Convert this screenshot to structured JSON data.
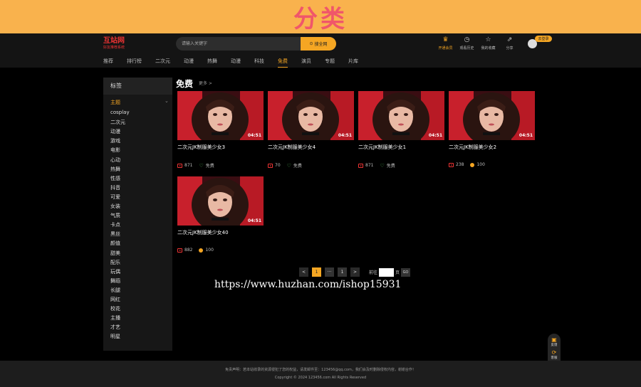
{
  "banner": {
    "title": "分类"
  },
  "header": {
    "logo_main": "互站网",
    "logo_sub": "好友推荐系统",
    "search_placeholder": "请输入关键字",
    "search_button": "搜全网",
    "icons": [
      {
        "icon": "crown-icon",
        "label": "开通会员"
      },
      {
        "icon": "clock-icon",
        "label": "观看历史"
      },
      {
        "icon": "star-icon",
        "label": "我的收藏"
      },
      {
        "icon": "share-icon",
        "label": "分享"
      }
    ],
    "login_badge": "去登录"
  },
  "nav": [
    "推荐",
    "排行榜",
    "二次元",
    "动漫",
    "热舞",
    "动漫",
    "科技",
    "免费",
    "演员",
    "专题",
    "片库"
  ],
  "nav_active_index": 7,
  "sidebar": {
    "title": "标签",
    "group": "主题",
    "tags": [
      "cosplay",
      "二次元",
      "动漫",
      "游戏",
      "电影",
      "心动",
      "热舞",
      "性感",
      "抖音",
      "可爱",
      "女装",
      "气质",
      "卡点",
      "黑丝",
      "颜值",
      "甜美",
      "配乐",
      "玩偶",
      "舞蹈",
      "长腿",
      "网红",
      "校花",
      "主播",
      "才艺",
      "明星"
    ]
  },
  "section": {
    "title": "免费",
    "more": "更多 >"
  },
  "videos": [
    {
      "title": "二次元JK制服美少女3",
      "duration": "04:51",
      "views": "871",
      "price": "免费",
      "paid": false
    },
    {
      "title": "二次元JK制服美少女4",
      "duration": "04:51",
      "views": "70",
      "price": "免费",
      "paid": false
    },
    {
      "title": "二次元JK制服美少女1",
      "duration": "04:51",
      "views": "871",
      "price": "免费",
      "paid": false
    },
    {
      "title": "二次元JK制服美少女2",
      "duration": "04:51",
      "views": "238",
      "price": "100",
      "paid": true
    },
    {
      "title": "二次元JK制服美少女40",
      "duration": "04:51",
      "views": "882",
      "price": "100",
      "paid": true
    }
  ],
  "pagination": {
    "prev": "<",
    "current": "1",
    "ellipsis": "···",
    "last": "1",
    "next": ">",
    "jump_prefix": "前往",
    "jump_suffix": "页",
    "go": "GO"
  },
  "watermark": "https://www.huzhan.com/ishop15931",
  "float_tools": [
    {
      "icon": "feedback-icon",
      "label": "反馈"
    },
    {
      "icon": "top-icon",
      "label": "客服"
    }
  ],
  "footer": {
    "disclaimer": "免责声明：若本站收录的资源侵犯了您的权益，请发邮件至：123456@qq.com，我们会及时删除侵权内容，谢谢合作！",
    "copyright": "Copyright © 2024 123456.com All Rights Reserved"
  },
  "colors": {
    "accent": "#f5a623",
    "banner": "#f9b24d",
    "banner_text": "#f0566a",
    "logo": "#e33333"
  }
}
